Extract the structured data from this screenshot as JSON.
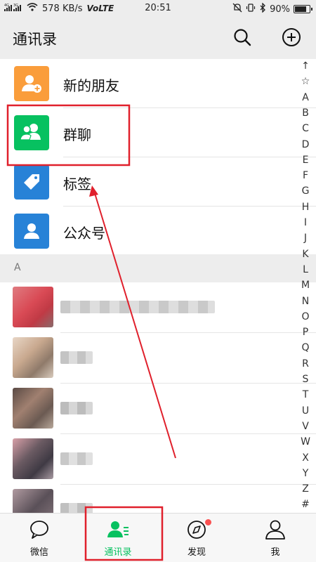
{
  "status_bar": {
    "net_type": "4G",
    "net_speed": "578 KB/s",
    "volte": "VoLTE",
    "time": "20:51",
    "battery": "90%"
  },
  "header": {
    "title": "通讯录",
    "search_icon": "search-icon",
    "add_icon": "plus-circle-icon"
  },
  "functions": [
    {
      "label": "新的朋友",
      "icon": "add-person-icon",
      "color": "#fa9d3b"
    },
    {
      "label": "群聊",
      "icon": "group-icon",
      "color": "#07c160"
    },
    {
      "label": "标签",
      "icon": "tag-icon",
      "color": "#2782d7"
    },
    {
      "label": "公众号",
      "icon": "person-icon",
      "color": "#2782d7"
    }
  ],
  "section_letter": "A",
  "index": [
    "↑",
    "☆",
    "A",
    "B",
    "C",
    "D",
    "E",
    "F",
    "G",
    "H",
    "I",
    "J",
    "K",
    "L",
    "M",
    "N",
    "O",
    "P",
    "Q",
    "R",
    "S",
    "T",
    "U",
    "V",
    "W",
    "X",
    "Y",
    "Z",
    "#"
  ],
  "tabs": [
    {
      "label": "微信",
      "icon": "chat-bubble-icon"
    },
    {
      "label": "通讯录",
      "icon": "contacts-icon"
    },
    {
      "label": "发现",
      "icon": "compass-icon"
    },
    {
      "label": "我",
      "icon": "person-outline-icon"
    }
  ],
  "colors": {
    "accent": "#07c160",
    "annotation_red": "#e0202c",
    "badge_red": "#fa5151"
  }
}
